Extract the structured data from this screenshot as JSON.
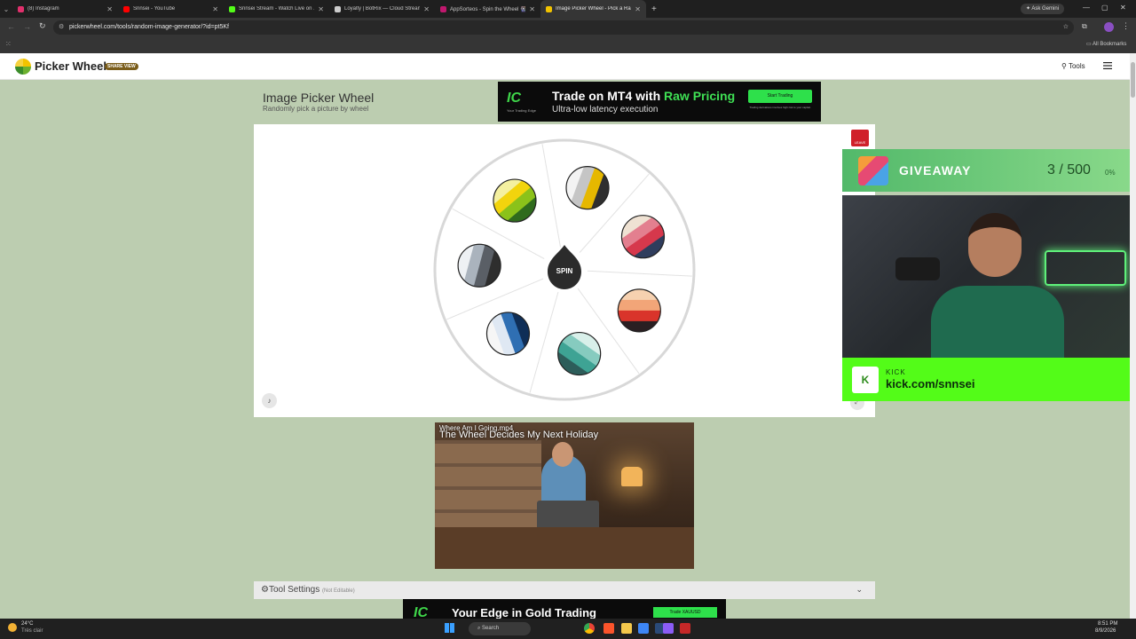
{
  "browser": {
    "tabs": [
      {
        "label": "(8) Instagram",
        "color": "#e1306c"
      },
      {
        "label": "Snnsei - YouTube",
        "color": "#ff0000"
      },
      {
        "label": "Snnsei Stream - Watch Live on ...",
        "color": "#53fc18"
      },
      {
        "label": "Loyalty | BotRix — Cloud Stream...",
        "color": "#cccccc"
      },
      {
        "label": "AppSorteos - Spin the Wheel 🎡",
        "color": "#c0186e"
      },
      {
        "label": "Image Picker Wheel - Pick a Ra...",
        "color": "#f2c300",
        "active": true
      }
    ],
    "new_tab_label": "+",
    "ask_gemini": "Ask Gemini",
    "url": "pickerwheel.com/tools/random-image-generator/?id=pt5Kf",
    "all_bookmarks": "All Bookmarks"
  },
  "site": {
    "logo_text": "Picker Wheel",
    "share_badge": "SHARE VIEW",
    "tools_label": "Tools",
    "page_title": "Image Picker Wheel",
    "page_subtitle": "Randomly pick a picture by wheel",
    "spin_label": "SPIN",
    "leave_label": "LEAVE",
    "tool_settings_label": "Tool Settings",
    "tool_settings_note": "(Not Editable)"
  },
  "wheel_items": [
    {
      "stripes": [
        "#f3f3f3",
        "#c5c5c5",
        "#e6b800",
        "#2f2f2f"
      ]
    },
    {
      "stripes": [
        "#efe2d3",
        "#e37f8f",
        "#d6384c",
        "#2f3d5d"
      ]
    },
    {
      "stripes": [
        "#f6d1b0",
        "#f2a578",
        "#d9342b",
        "#2a1f22"
      ]
    },
    {
      "stripes": [
        "#d9f0ea",
        "#86cbbf",
        "#3ea394",
        "#2d5d5a"
      ]
    },
    {
      "stripes": [
        "#0f2e57",
        "#2f6fb3",
        "#dfe8f3",
        "#f6f6f6"
      ]
    },
    {
      "stripes": [
        "#2e2e2e",
        "#5a5f66",
        "#aab3bd",
        "#eef1f4"
      ]
    },
    {
      "stripes": [
        "#2f6b1d",
        "#8bc21a",
        "#f2d40d",
        "#f4f0a0"
      ]
    }
  ],
  "ads": {
    "top": {
      "brand": "IC",
      "brand_sub": "Your Trading Edge",
      "headline_a": "Trade on MT4 with ",
      "headline_b": "Raw Pricing",
      "sub": "Ultra-low latency execution",
      "cta": "Start Trading",
      "fine": "Trading derivatives involves high risk to your capital."
    },
    "bottom": {
      "brand": "IC",
      "headline": "Your Edge in Gold Trading",
      "cta": "Trade XAUUSD"
    }
  },
  "video": {
    "file_name": "Where Am I Going.mp4",
    "caption": "The Wheel Decides My Next Holiday"
  },
  "overlay": {
    "giveaway_label": "GIVEAWAY",
    "giveaway_count": "3 / 500",
    "giveaway_percent": "0%",
    "kick_label": "KICK",
    "kick_url": "kick.com/snnsei"
  },
  "taskbar": {
    "weather_temp": "24°C",
    "weather_desc": "Très clair",
    "search_label": "Search",
    "time": "8:51 PM",
    "date": "8/9/2026"
  }
}
